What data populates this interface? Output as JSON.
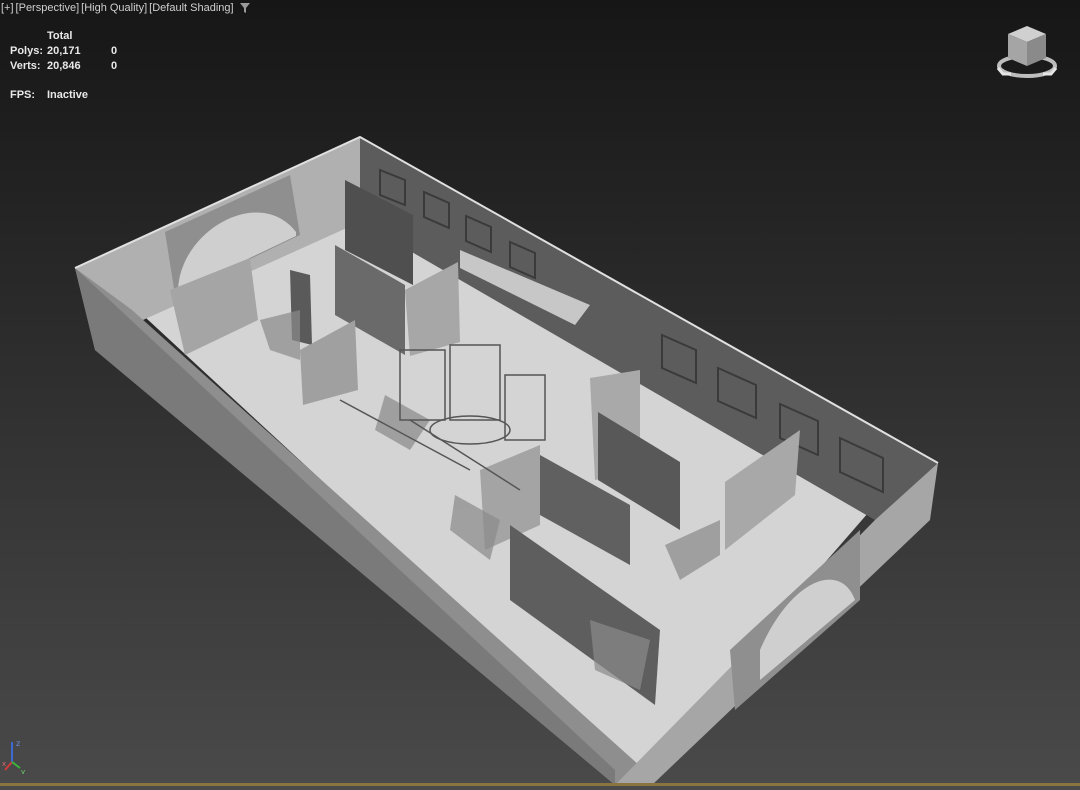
{
  "viewport": {
    "labels": [
      "[+]",
      "[Perspective]",
      "[High Quality]",
      "[Default Shading]"
    ],
    "filter_icon": "filter-icon"
  },
  "stats": {
    "total_header": "Total",
    "polys_label": "Polys:",
    "polys_total": "20,171",
    "polys_selected": "0",
    "verts_label": "Verts:",
    "verts_total": "20,846",
    "verts_selected": "0",
    "fps_label": "FPS:",
    "fps_value": "Inactive"
  },
  "gizmo": {
    "axis_z": "z",
    "axis_x": "x",
    "axis_y": "y",
    "colors": {
      "x": "#d23a3a",
      "y": "#3ab43a",
      "z": "#3a6ad2"
    }
  },
  "colors": {
    "floor": "#d4d4d4",
    "wall_light": "#a9a9a9",
    "wall_dark": "#5a5a5a",
    "accent_rule": "#8a7440"
  }
}
